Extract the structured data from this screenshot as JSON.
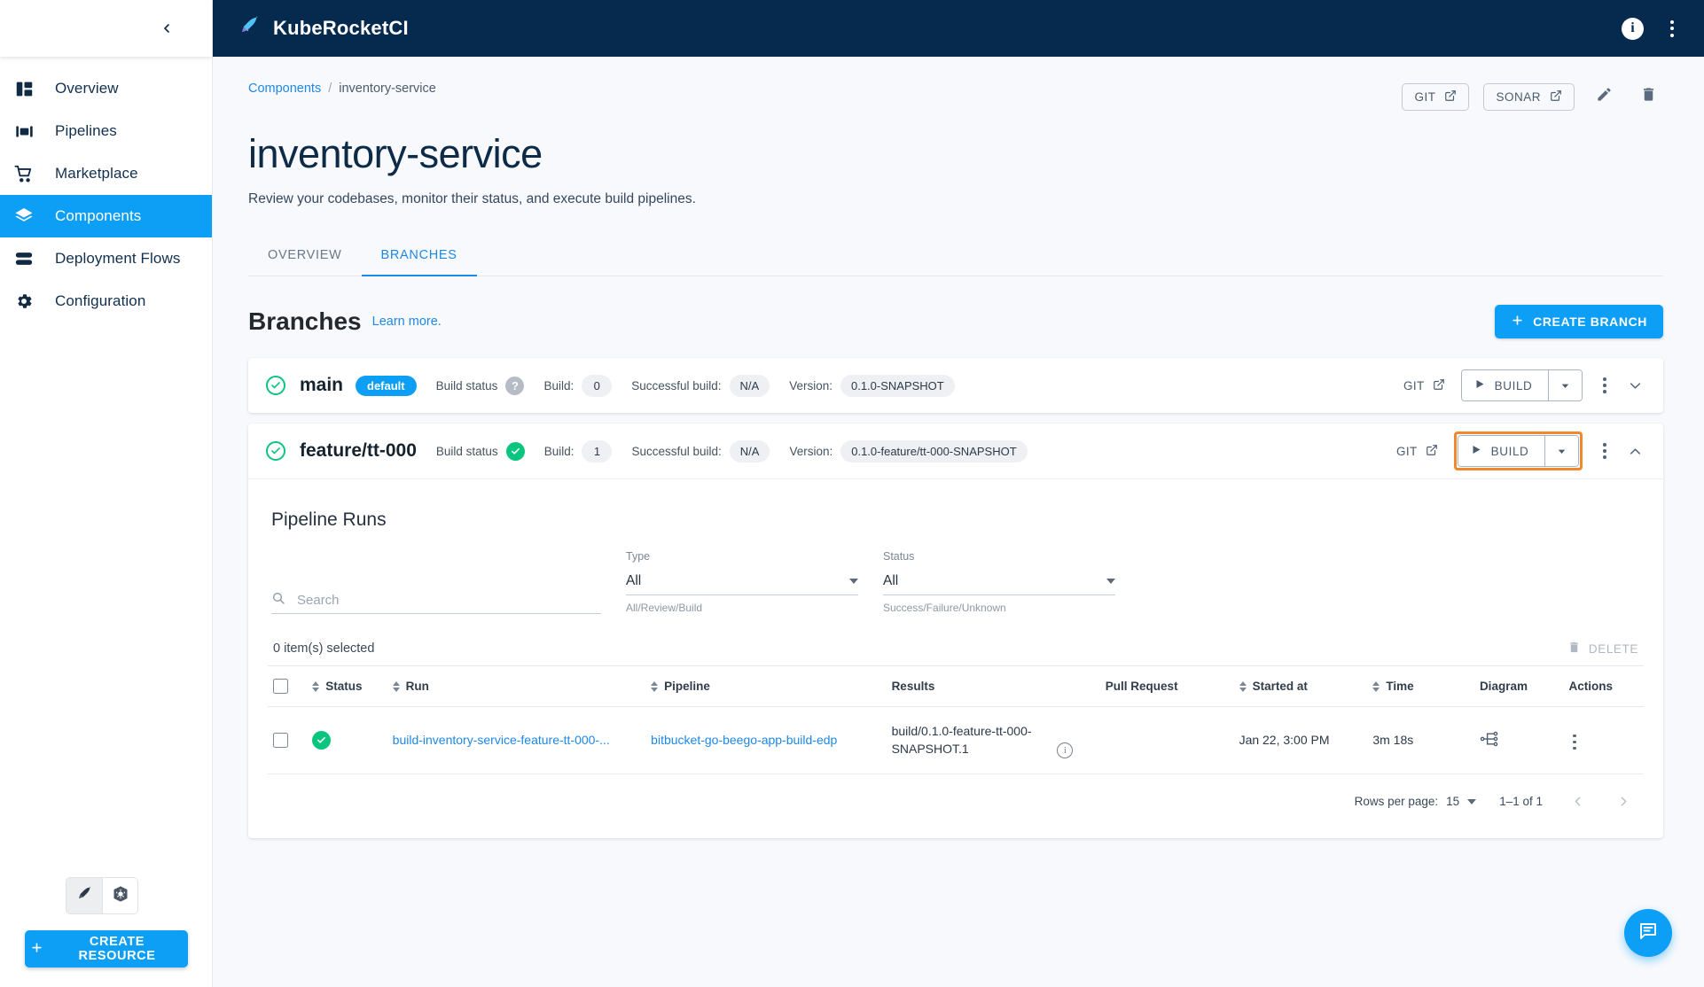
{
  "app": {
    "brand": "KubeRocketCI",
    "brand_icon": "rocket-pen-icon",
    "info_icon": "i",
    "collapse_icon": "chevron-left-icon"
  },
  "sidebar": {
    "items": [
      {
        "label": "Overview",
        "icon": "dashboard-icon",
        "active": false
      },
      {
        "label": "Pipelines",
        "icon": "pipelines-icon",
        "active": false
      },
      {
        "label": "Marketplace",
        "icon": "cart-icon",
        "active": false
      },
      {
        "label": "Components",
        "icon": "layers-icon",
        "active": true
      },
      {
        "label": "Deployment Flows",
        "icon": "flows-icon",
        "active": false
      },
      {
        "label": "Configuration",
        "icon": "gear-icon",
        "active": false
      }
    ],
    "mode_toggle": [
      {
        "icon": "kuberocket-icon",
        "selected": true
      },
      {
        "icon": "kubernetes-icon",
        "selected": false
      }
    ],
    "create_resource_label": "CREATE RESOURCE"
  },
  "breadcrumb": {
    "parent": "Components",
    "separator": "/",
    "current": "inventory-service"
  },
  "header_actions": {
    "git_label": "GIT",
    "sonar_label": "SONAR",
    "edit_icon": "pencil-icon",
    "delete_icon": "trash-icon"
  },
  "page": {
    "title": "inventory-service",
    "subtitle": "Review your codebases, monitor their status, and execute build pipelines."
  },
  "tabs": [
    {
      "label": "OVERVIEW",
      "active": false
    },
    {
      "label": "BRANCHES",
      "active": true
    }
  ],
  "branches_section": {
    "title": "Branches",
    "learn_more": "Learn more.",
    "create_label": "CREATE BRANCH"
  },
  "branches": [
    {
      "name": "main",
      "status_icon": "check-circle-outline-icon",
      "default_badge": "default",
      "build_status_label": "Build status",
      "build_status_value": "unknown",
      "build_status_glyph": "?",
      "build_label": "Build:",
      "build_value": "0",
      "successful_label": "Successful build:",
      "successful_value": "N/A",
      "version_label": "Version:",
      "version_value": "0.1.0-SNAPSHOT",
      "git_label": "GIT",
      "build_button": "BUILD",
      "expanded": false,
      "highlighted": false
    },
    {
      "name": "feature/tt-000",
      "status_icon": "check-circle-outline-icon",
      "default_badge": null,
      "build_status_label": "Build status",
      "build_status_value": "success",
      "build_status_glyph": "✓",
      "build_label": "Build:",
      "build_value": "1",
      "successful_label": "Successful build:",
      "successful_value": "N/A",
      "version_label": "Version:",
      "version_value": "0.1.0-feature/tt-000-SNAPSHOT",
      "git_label": "GIT",
      "build_button": "BUILD",
      "expanded": true,
      "highlighted": true
    }
  ],
  "pipeline_runs": {
    "title": "Pipeline Runs",
    "search": {
      "value": "",
      "placeholder": "Search"
    },
    "type_filter": {
      "label": "Type",
      "value": "All",
      "help": "All/Review/Build"
    },
    "status_filter": {
      "label": "Status",
      "value": "All",
      "help": "Success/Failure/Unknown"
    },
    "selected_text": "0 item(s) selected",
    "delete_label": "DELETE",
    "columns": [
      "Status",
      "Run",
      "Pipeline",
      "Results",
      "Pull Request",
      "Started at",
      "Time",
      "Diagram",
      "Actions"
    ],
    "rows": [
      {
        "status": "success",
        "run": "build-inventory-service-feature-tt-000-...",
        "pipeline": "bitbucket-go-beego-app-build-edp",
        "results": "build/0.1.0-feature-tt-000-SNAPSHOT.1",
        "pull_request": "",
        "started_at": "Jan 22, 3:00 PM",
        "time": "3m 18s",
        "diagram_icon": "diagram-icon",
        "actions_icon": "kebab-icon"
      }
    ],
    "pagination": {
      "rows_per_page_label": "Rows per page:",
      "rows_per_page_value": "15",
      "range": "1–1 of 1"
    }
  },
  "fab": {
    "icon": "chat-icon"
  },
  "colors": {
    "topbar": "#052a4e",
    "accent": "#0d9ef5",
    "link": "#1e88e5",
    "success": "#0ac57f",
    "highlight": "#f2882b",
    "page_bg": "#f7f9fc"
  }
}
